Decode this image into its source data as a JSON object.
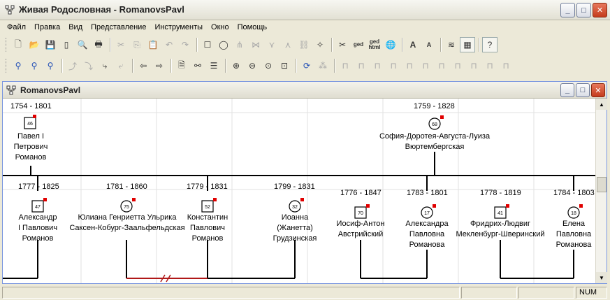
{
  "window": {
    "title": "Живая Родословная - RomanovsPavl",
    "app_icon": "tree-icon",
    "btn_minimize": "_",
    "btn_maximize": "□",
    "btn_close": "✕"
  },
  "menu": [
    "Файл",
    "Правка",
    "Вид",
    "Представление",
    "Инструменты",
    "Окно",
    "Помощь"
  ],
  "toolbar_labels": {
    "ged": "ged",
    "ged_html": "ged\nhtml"
  },
  "child_window": {
    "title": "RomanovsPavl"
  },
  "nodes": [
    {
      "id": "p1",
      "dates": "1754 - 1801",
      "number": "46",
      "sex": "male",
      "name": [
        "Павел I",
        "Петрович",
        "Романов"
      ]
    },
    {
      "id": "p2",
      "dates": "1759 - 1828",
      "number": "68",
      "sex": "female",
      "name": [
        "София-Доротея-Августа-Луиза",
        "Вюртембергская"
      ]
    },
    {
      "id": "c1",
      "dates": "1777 - 1825",
      "number": "47",
      "sex": "male",
      "name": [
        "Александр",
        "I Павлович",
        "Романов"
      ]
    },
    {
      "id": "s1",
      "dates": "1781 - 1860",
      "number": "75",
      "sex": "female",
      "name": [
        "Юлиана Генриетта Ульрика",
        "Саксен-Кобург-Заальфельдская"
      ]
    },
    {
      "id": "c2",
      "dates": "1779 - 1831",
      "number": "52",
      "sex": "male",
      "name": [
        "Константин",
        "Павлович",
        "Романов"
      ]
    },
    {
      "id": "s2",
      "dates": "1799 - 1831",
      "number": "32",
      "sex": "female",
      "name": [
        "Иоанна",
        "(Жанетта)",
        "Грудзинская"
      ]
    },
    {
      "id": "s3",
      "dates": "1776 - 1847",
      "number": "70",
      "sex": "male",
      "name": [
        "Иосиф-Антон",
        "Австрийский"
      ]
    },
    {
      "id": "c3",
      "dates": "1783 - 1801",
      "number": "17",
      "sex": "female",
      "name": [
        "Александра",
        "Павловна",
        "Романова"
      ]
    },
    {
      "id": "s4",
      "dates": "1778 - 1819",
      "number": "41",
      "sex": "male",
      "name": [
        "Фридрих-Людвиг",
        "Мекленбург-Шверинский"
      ]
    },
    {
      "id": "c4",
      "dates": "1784 - 1803",
      "number": "18",
      "sex": "female",
      "name": [
        "Елена",
        "Павловна",
        "Романова"
      ]
    }
  ],
  "status": {
    "num": "NUM"
  }
}
